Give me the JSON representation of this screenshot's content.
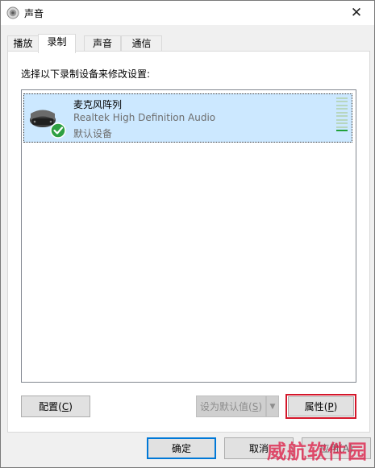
{
  "window": {
    "title": "声音",
    "close_glyph": "✕"
  },
  "tabs": [
    {
      "label": "播放",
      "active": false
    },
    {
      "label": "录制",
      "active": true
    },
    {
      "label": "声音",
      "active": false
    },
    {
      "label": "通信",
      "active": false
    }
  ],
  "recording": {
    "instruction": "选择以下录制设备来修改设置:",
    "devices": [
      {
        "name": "麦克风阵列",
        "driver": "Realtek High Definition Audio",
        "status": "默认设备",
        "selected": true,
        "is_default": true,
        "icon": "microphone-array-icon",
        "level_fraction": 0.08
      }
    ]
  },
  "buttons": {
    "configure": {
      "label": "配置",
      "mnemonic": "C"
    },
    "set_default": {
      "label": "设为默认值",
      "mnemonic": "S",
      "enabled": false
    },
    "properties": {
      "label": "属性",
      "mnemonic": "P"
    },
    "ok": {
      "label": "确定"
    },
    "cancel": {
      "label": "取消"
    },
    "apply": {
      "label": "应用",
      "mnemonic": "A",
      "partial_visible": "应用(A)"
    }
  },
  "watermark": {
    "text": "威航软件园"
  },
  "colors": {
    "selection": "#cce8ff",
    "focus_blue": "#0078d7",
    "highlight_red": "#d3162a",
    "level_green": "#21a13a",
    "check_green": "#2ea043"
  }
}
